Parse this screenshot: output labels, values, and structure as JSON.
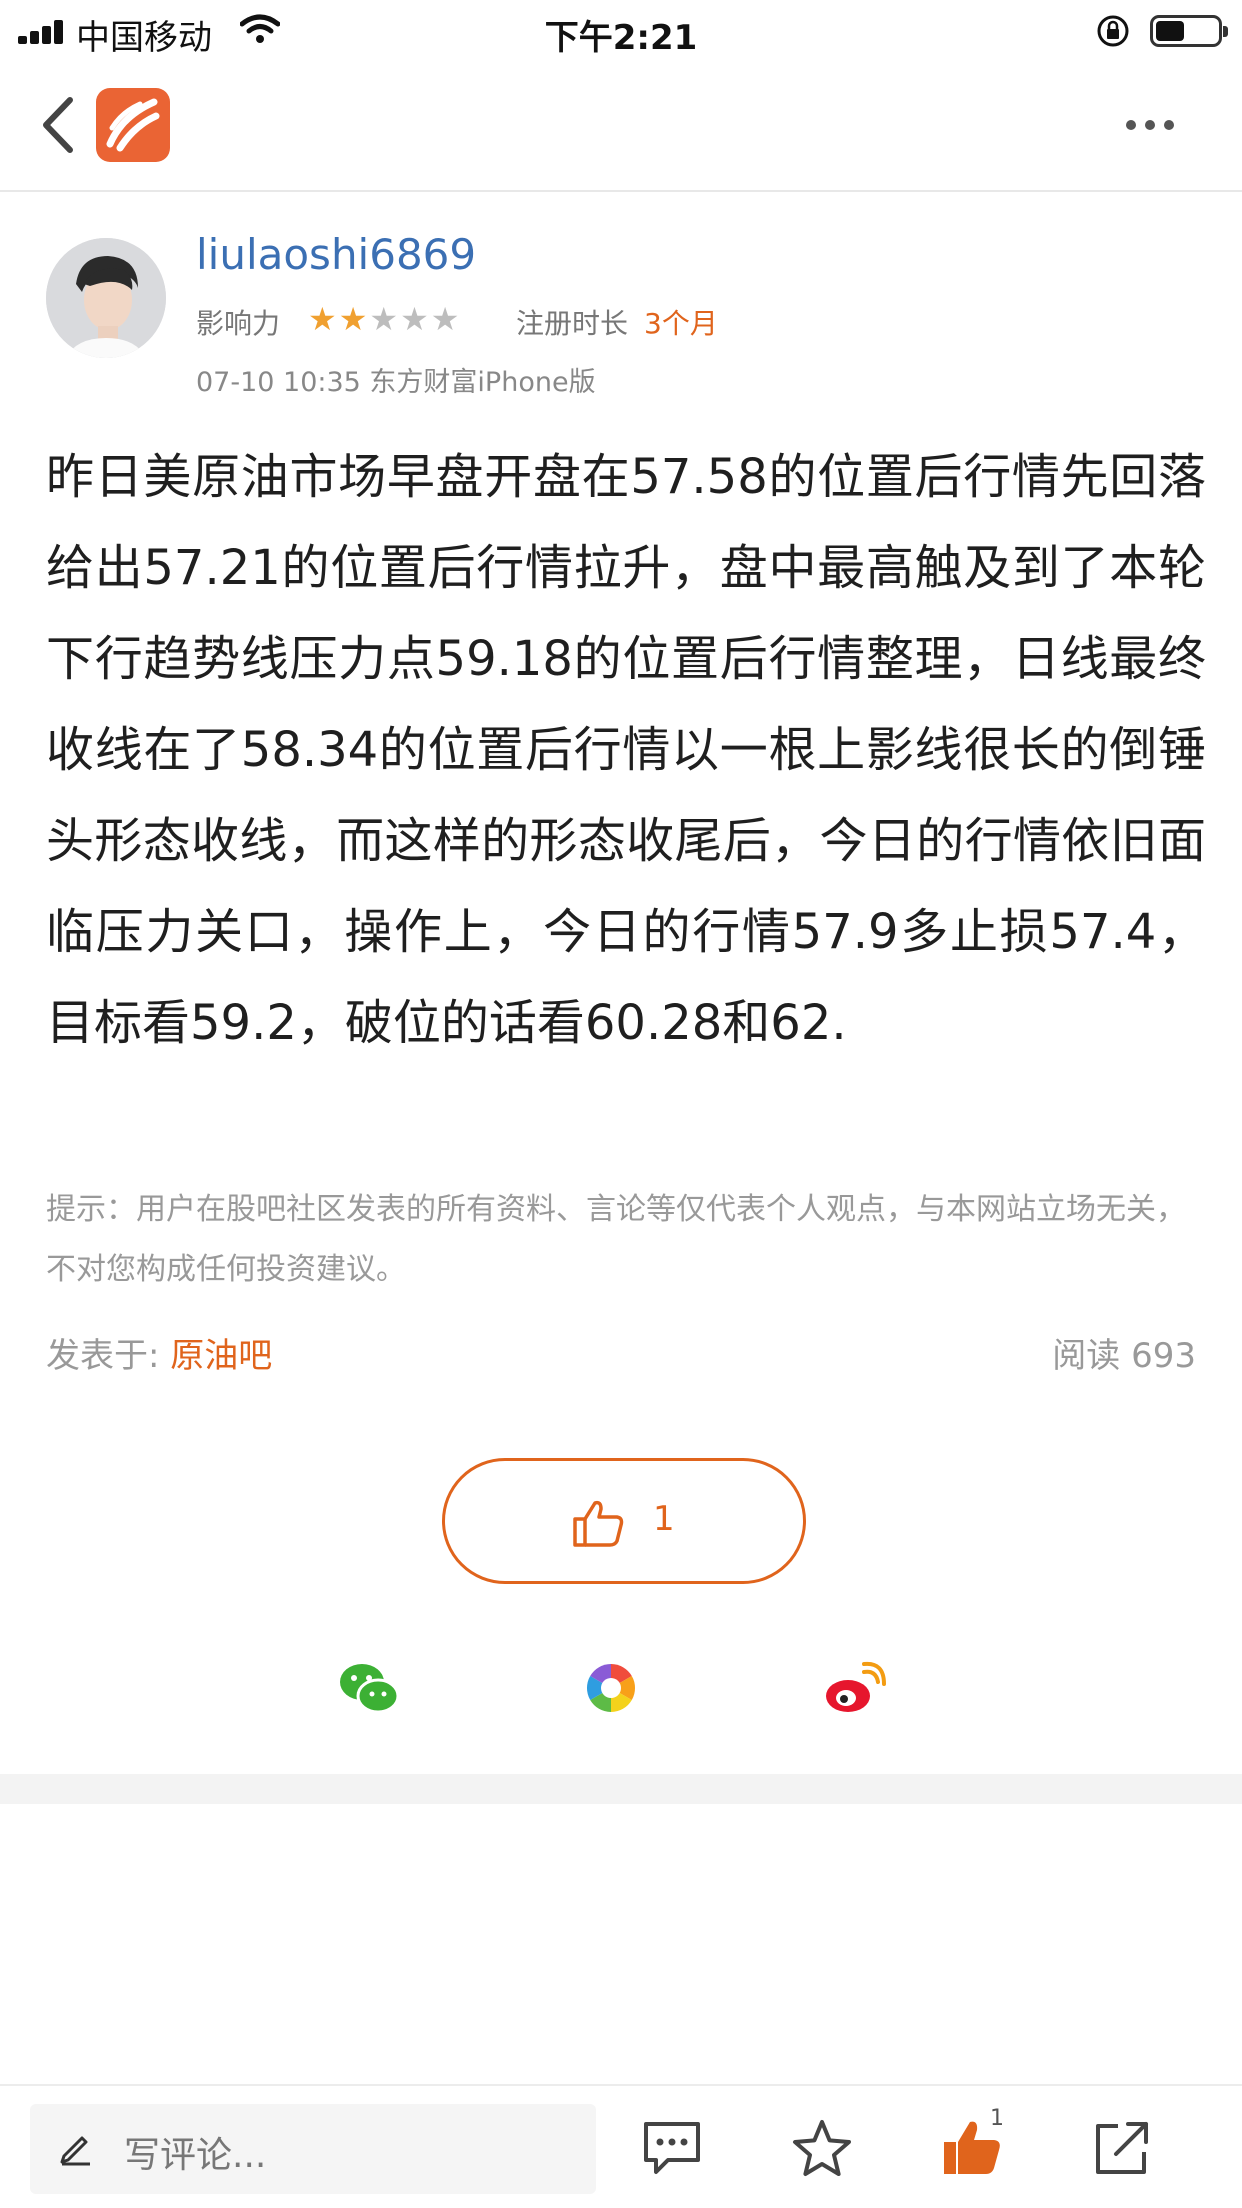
{
  "status_bar": {
    "carrier": "中国移动",
    "time": "下午2:21"
  },
  "post": {
    "author": {
      "username": "liulaoshi6869",
      "influence_label": "影响力",
      "influence_rating": 2,
      "influence_max": 5,
      "registration_label": "注册时长",
      "registration_value": "3个月"
    },
    "meta": "07-10 10:35 东方财富iPhone版",
    "body": "昨日美原油市场早盘开盘在57.58的位置后行情先回落给出57.21的位置后行情拉升，盘中最高触及到了本轮下行趋势线压力点59.18的位置后行情整理，日线最终收线在了58.34的位置后行情以一根上影线很长的倒锤头形态收线，而这样的形态收尾后，今日的行情依旧面临压力关口，操作上，今日的行情57.9多止损57.4，目标看59.2，破位的话看60.28和62.",
    "disclaimer": "提示：用户在股吧社区发表的所有资料、言论等仅代表个人观点，与本网站立场无关，不对您构成任何投资建议。",
    "posted_in_label": "发表于:",
    "forum": "原油吧",
    "read_label": "阅读 693",
    "like_count": "1"
  },
  "share": {
    "items": [
      "wechat-icon",
      "moments-icon",
      "weibo-icon"
    ]
  },
  "toolbar": {
    "comment_placeholder": "写评论...",
    "like_badge": "1"
  },
  "colors": {
    "accent": "#e0641c",
    "username": "#3b6fb3",
    "logo": "#ea6434"
  }
}
